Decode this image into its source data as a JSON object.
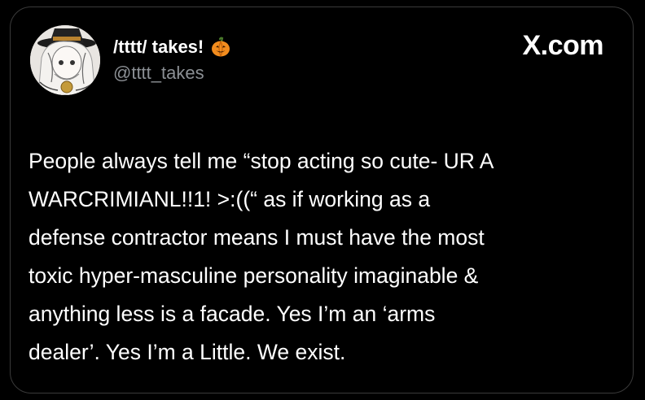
{
  "author": {
    "display_name": "/tttt/ takes!",
    "handle": "@tttt_takes",
    "name_badge_icon": "pumpkin-icon"
  },
  "brand": {
    "label": "X.com"
  },
  "tweet": {
    "lines": [
      "People always tell me “stop acting so cute- UR A",
      "WARCRIMIANL!!1! >:((“ as if working as a",
      "defense contractor means I must have the most",
      "toxic hyper-masculine personality imaginable &",
      "anything less is a facade. Yes I’m an ‘arms",
      "dealer’. Yes I’m a Little. We exist."
    ]
  },
  "colors": {
    "background": "#000000",
    "text_primary": "#ffffff",
    "text_secondary": "#8b8f94",
    "card_border": "#3a3a3a",
    "pumpkin": "#f28c1e"
  }
}
